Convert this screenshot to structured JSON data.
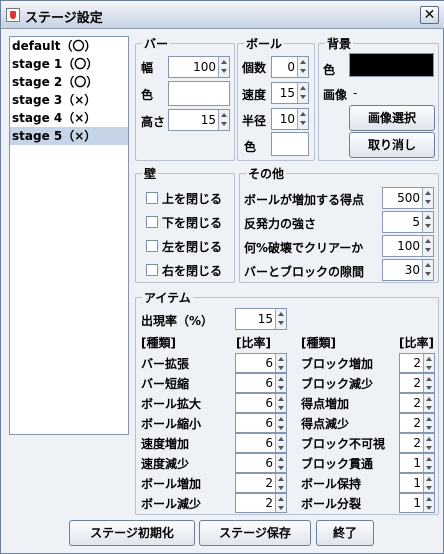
{
  "window": {
    "title": "ステージ設定"
  },
  "stages": [
    "default（〇）",
    "stage 1（〇）",
    "stage 2（〇）",
    "stage 3（×）",
    "stage 4（×）",
    "stage 5（×）"
  ],
  "selected_stage_index": 5,
  "bar": {
    "legend": "バー",
    "width_label": "幅",
    "width_value": "100",
    "color_label": "色",
    "height_label": "高さ",
    "height_value": "15"
  },
  "ball": {
    "legend": "ボール",
    "count_label": "個数",
    "count_value": "0",
    "speed_label": "速度",
    "speed_value": "15",
    "radius_label": "半径",
    "radius_value": "10",
    "color_label": "色"
  },
  "background": {
    "legend": "背景",
    "color_label": "色",
    "color_hex": "#000000",
    "image_label": "画像",
    "image_value": "-",
    "select_button": "画像選択",
    "cancel_button": "取り消し"
  },
  "wall": {
    "legend": "壁",
    "items": [
      "上を閉じる",
      "下を閉じる",
      "左を閉じる",
      "右を閉じる"
    ]
  },
  "other": {
    "legend": "その他",
    "rows": [
      {
        "label": "ボールが増加する得点",
        "value": "500"
      },
      {
        "label": "反発力の強さ",
        "value": "5"
      },
      {
        "label": "何%破壊でクリアーか",
        "value": "100"
      },
      {
        "label": "バーとブロックの隙間",
        "value": "30"
      }
    ]
  },
  "item": {
    "legend": "アイテム",
    "rate_label": "出現率（%）",
    "rate_value": "15",
    "col_type": "[種類]",
    "col_ratio": "[比率]",
    "left": [
      {
        "name": "バー拡張",
        "ratio": "6"
      },
      {
        "name": "バー短縮",
        "ratio": "6"
      },
      {
        "name": "ボール拡大",
        "ratio": "6"
      },
      {
        "name": "ボール縮小",
        "ratio": "6"
      },
      {
        "name": "速度増加",
        "ratio": "6"
      },
      {
        "name": "速度減少",
        "ratio": "6"
      },
      {
        "name": "ボール増加",
        "ratio": "2"
      },
      {
        "name": "ボール減少",
        "ratio": "2"
      }
    ],
    "right": [
      {
        "name": "ブロック増加",
        "ratio": "2"
      },
      {
        "name": "ブロック減少",
        "ratio": "2"
      },
      {
        "name": "得点増加",
        "ratio": "2"
      },
      {
        "name": "得点減少",
        "ratio": "2"
      },
      {
        "name": "ブロック不可視",
        "ratio": "2"
      },
      {
        "name": "ブロック貫通",
        "ratio": "1"
      },
      {
        "name": "ボール保持",
        "ratio": "1"
      },
      {
        "name": "ボール分裂",
        "ratio": "1"
      }
    ]
  },
  "buttons": {
    "init": "ステージ初期化",
    "save": "ステージ保存",
    "exit": "終了"
  }
}
